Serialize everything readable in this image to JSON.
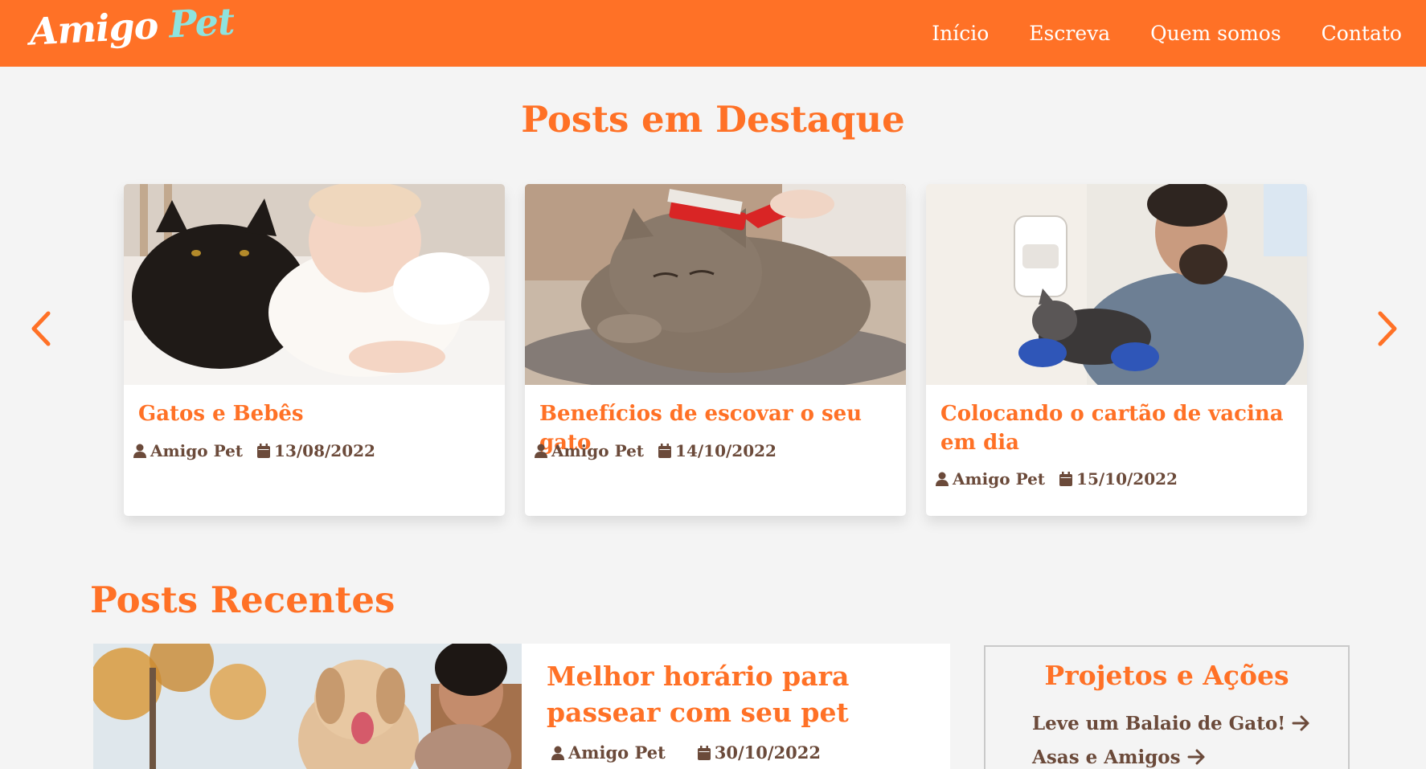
{
  "brand": {
    "logo_word1": "Amigo",
    "logo_word2": "Pet",
    "primary_color": "#ff7126",
    "accent_color": "#8ee3de"
  },
  "nav": {
    "items": [
      "Início",
      "Escreva",
      "Quem somos",
      "Contato"
    ]
  },
  "featured": {
    "heading": "Posts em Destaque",
    "cards": [
      {
        "title": "Gatos e Bebês",
        "author": "Amigo Pet",
        "date": "13/08/2022",
        "image_desc": "black cat lying next to a baby"
      },
      {
        "title": "Benefícios de escovar o seu gato",
        "author": "Amigo Pet",
        "date": "14/10/2022",
        "image_desc": "tabby cat being brushed"
      },
      {
        "title": "Colocando o cartão de vacina em dia",
        "author": "Amigo Pet",
        "date": "15/10/2022",
        "image_desc": "veterinarian holding a cat"
      }
    ]
  },
  "recent": {
    "heading": "Posts Recentes",
    "post": {
      "title": "Melhor horário para passear com seu pet",
      "author": "Amigo Pet",
      "date": "30/10/2022",
      "image_desc": "woman hugging a golden retriever outdoors"
    }
  },
  "projects": {
    "heading": "Projetos e Ações",
    "links": [
      "Leve um Balaio de Gato!",
      "Asas e Amigos"
    ]
  },
  "icons": {
    "prev": "chevron-left-icon",
    "next": "chevron-right-icon",
    "author": "user-icon",
    "date": "calendar-icon",
    "link": "arrow-right-icon"
  }
}
